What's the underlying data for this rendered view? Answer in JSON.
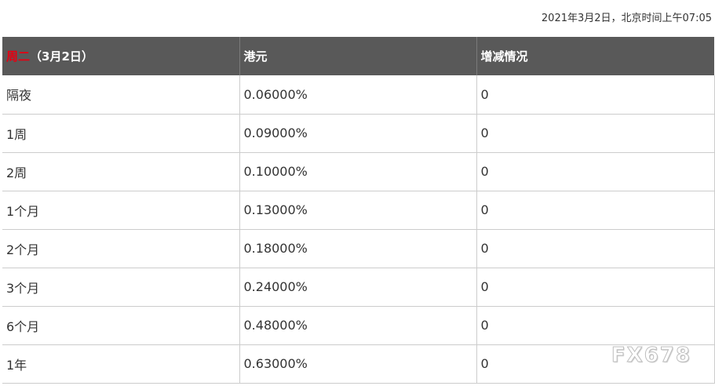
{
  "timestamp": "2021年3月2日，北京时间上午07:05",
  "table": {
    "headers": {
      "day": "周二",
      "date": "（3月2日）",
      "currency": "港元",
      "change": "增减情况"
    },
    "rows": [
      {
        "term": "隔夜",
        "rate": "0.06000%",
        "change": "0"
      },
      {
        "term": "1周",
        "rate": "0.09000%",
        "change": "0"
      },
      {
        "term": "2周",
        "rate": "0.10000%",
        "change": "0"
      },
      {
        "term": "1个月",
        "rate": "0.13000%",
        "change": "0"
      },
      {
        "term": "2个月",
        "rate": "0.18000%",
        "change": "0"
      },
      {
        "term": "3个月",
        "rate": "0.24000%",
        "change": "0"
      },
      {
        "term": "6个月",
        "rate": "0.48000%",
        "change": "0"
      },
      {
        "term": "1年",
        "rate": "0.63000%",
        "change": "0"
      }
    ]
  },
  "watermark": "FX678",
  "colors": {
    "header_bg": "#595959",
    "header_day": "#e60012",
    "text": "#333333",
    "grid": "#cccccc"
  }
}
